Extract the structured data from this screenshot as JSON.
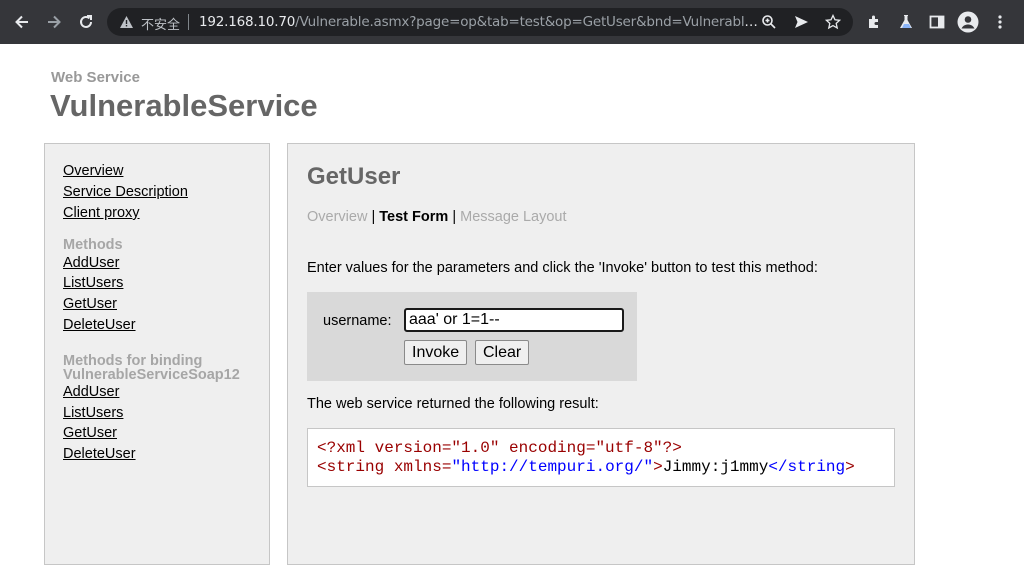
{
  "browser": {
    "not_secure_label": "不安全",
    "url_host": "192.168.10.70",
    "url_path": "/Vulnerable.asmx?page=op&tab=test&op=GetUser&bnd=VulnerableServic…",
    "icons": [
      "back-arrow-icon",
      "forward-arrow-icon",
      "reload-icon",
      "warning-icon",
      "zoom-icon",
      "send-icon",
      "star-icon",
      "extensions-icon",
      "labs-flask-icon",
      "side-panel-icon",
      "profile-icon",
      "menu-icon"
    ]
  },
  "header": {
    "label": "Web Service",
    "title": "VulnerableService"
  },
  "sidebar": {
    "links": [
      "Overview",
      "Service Description",
      "Client proxy"
    ],
    "methods_heading": "Methods",
    "methods": [
      "AddUser",
      "ListUsers",
      "GetUser",
      "DeleteUser"
    ],
    "binding_heading_1": "Methods for binding",
    "binding_heading_2": "VulnerableServiceSoap12",
    "binding_methods": [
      "AddUser",
      "ListUsers",
      "GetUser",
      "DeleteUser"
    ]
  },
  "main": {
    "method_title": "GetUser",
    "tab_overview": "Overview",
    "tab_sep": " | ",
    "tab_test_form": "Test Form",
    "tab_message_layout": "Message Layout",
    "instructions": "Enter values for the parameters and click the 'Invoke' button to test this method:",
    "param_label": "username:",
    "param_value": "aaa' or 1=1--",
    "invoke_label": "Invoke",
    "clear_label": "Clear",
    "result_label": "The web service returned the following result:",
    "result_line1": "<?xml version=\"1.0\" encoding=\"utf-8\"?>",
    "result_open_tag": "<string",
    "result_attr": " xmlns=",
    "result_attr_val": "\"http://tempuri.org/\"",
    "result_gt": ">",
    "result_text": "Jimmy:j1mmy",
    "result_close_tag": "</string",
    "result_close_gt": ">"
  },
  "colors": {
    "toolbar_bg": "#35363a",
    "panel_bg": "#efefef",
    "heading_gray": "#666666",
    "xml_red": "#990000",
    "xml_blue": "#0000ff"
  }
}
